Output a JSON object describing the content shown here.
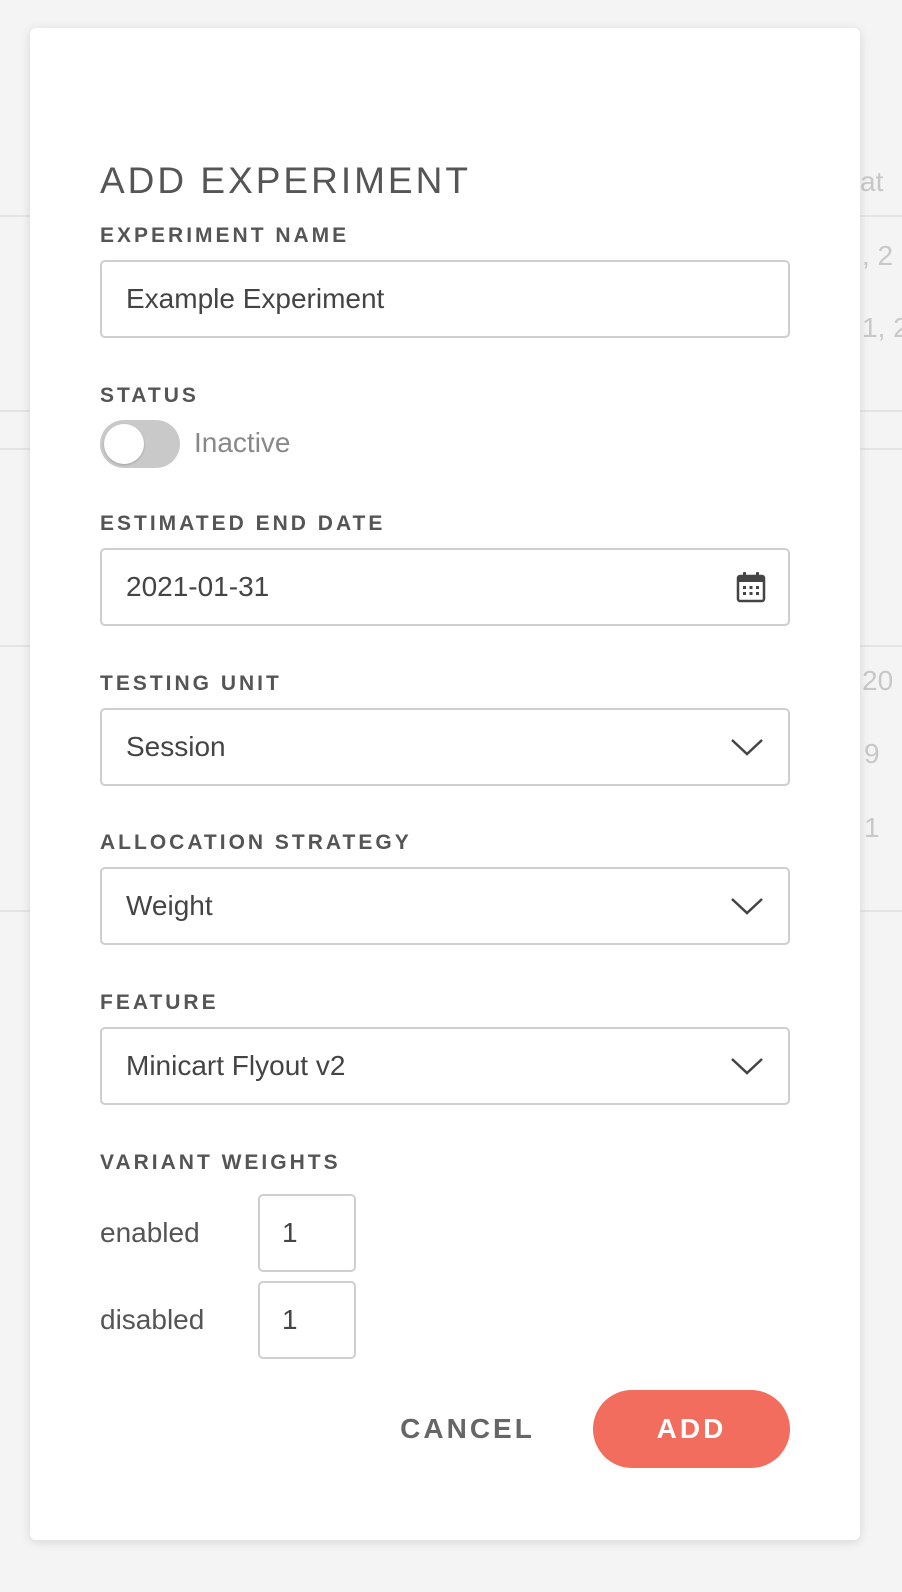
{
  "modal": {
    "title": "ADD EXPERIMENT",
    "experiment_name": {
      "label": "EXPERIMENT NAME",
      "value": "Example Experiment"
    },
    "status": {
      "label": "STATUS",
      "toggle_text": "Inactive",
      "active": false
    },
    "end_date": {
      "label": "ESTIMATED END DATE",
      "value": "2021-01-31",
      "icon": "calendar-icon"
    },
    "testing_unit": {
      "label": "TESTING UNIT",
      "value": "Session",
      "icon": "chevron-down-icon"
    },
    "allocation_strategy": {
      "label": "ALLOCATION STRATEGY",
      "value": "Weight",
      "icon": "chevron-down-icon"
    },
    "feature": {
      "label": "FEATURE",
      "value": "Minicart Flyout v2",
      "icon": "chevron-down-icon"
    },
    "variant_weights": {
      "label": "VARIANT WEIGHTS",
      "items": [
        {
          "name": "enabled",
          "value": "1"
        },
        {
          "name": "disabled",
          "value": "1"
        }
      ]
    },
    "actions": {
      "cancel": "CANCEL",
      "add": "ADD"
    }
  },
  "background": {
    "fragments": [
      "at",
      ", 2",
      "1, 2",
      "20",
      "9",
      "1"
    ]
  },
  "colors": {
    "accent": "#f26d5e",
    "toggle_off": "#c9c9c9",
    "border": "#cfcfcf"
  }
}
